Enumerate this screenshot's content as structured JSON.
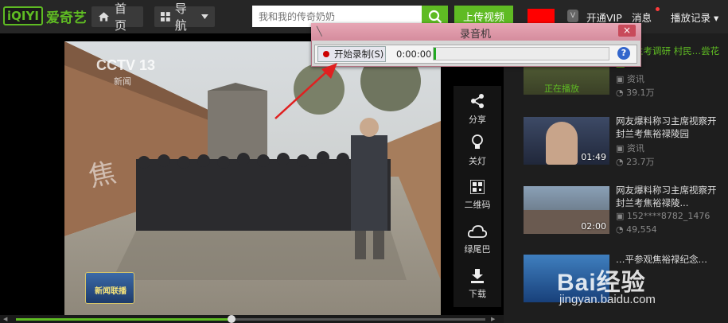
{
  "topbar": {
    "logo_box": "iQIYI",
    "logo_text": "爱奇艺",
    "home_label": "首页",
    "nav_label": "导航",
    "search_placeholder": "我和我的传奇奶奶",
    "upload_label": "上传视频",
    "vip_label": "开通VIP",
    "message_label": "消息",
    "history_label": "播放记录"
  },
  "video": {
    "channel_logo": "CCTV 13",
    "channel_sub": "新闻",
    "program_logo": "新闻联播",
    "wall_text": "焦"
  },
  "tools": [
    {
      "label": "分享",
      "icon": "share-icon"
    },
    {
      "label": "关灯",
      "icon": "lightbulb-icon"
    },
    {
      "label": "二维码",
      "icon": "qrcode-icon"
    },
    {
      "label": "绿尾巴",
      "icon": "cloud-icon"
    },
    {
      "label": "下载",
      "icon": "download-icon"
    }
  ],
  "progress": {
    "fraction": 0.46,
    "left": "◀",
    "right": "▶"
  },
  "related": [
    {
      "title": "…赴兰考调研 村民…尝花生",
      "badge": "正在播放",
      "source": "资讯",
      "views": "39.1万",
      "duration": ""
    },
    {
      "title": "网友爆料称习主席视察开封兰考焦裕禄陵园",
      "badge": "",
      "source": "资讯",
      "views": "23.7万",
      "duration": "01:49"
    },
    {
      "title": "网友爆料称习主席视察开封兰考焦裕禄陵...",
      "badge": "",
      "source": "152****8782_1476",
      "views": "49,554",
      "duration": "02:00"
    },
    {
      "title": "…平参观焦裕禄纪念…",
      "badge": "",
      "source": "",
      "views": "",
      "duration": ""
    }
  ],
  "recorder": {
    "title": "录音机",
    "start_label": "开始录制(S)",
    "time": "0:00:00",
    "help": "?",
    "close": "×",
    "level": 0.01
  },
  "watermark": {
    "logo": "Bai经验",
    "url": "jingyan.baidu.com"
  },
  "colors": {
    "accent": "#5fbb23",
    "topbar": "#262626",
    "recorder_title": "#e7a6b5"
  }
}
